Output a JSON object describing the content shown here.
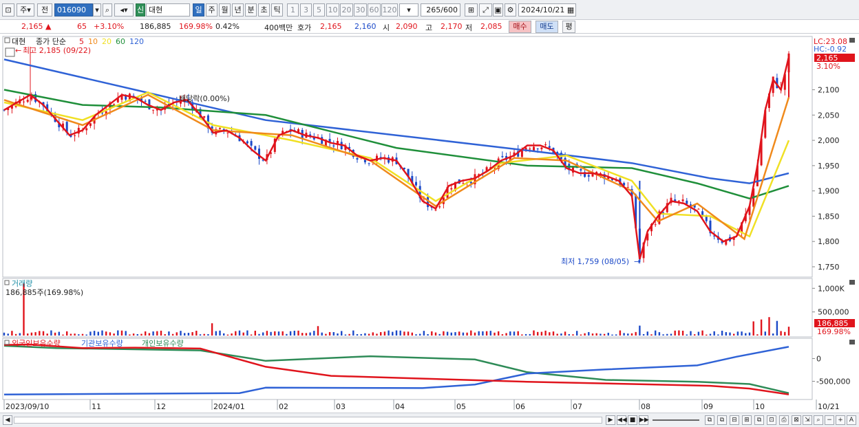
{
  "toolbar": {
    "period_main": "주",
    "prev_label": "전",
    "code": "016090",
    "name": "대현",
    "name_badge": "신",
    "periods": [
      "일",
      "주",
      "월",
      "년",
      "분",
      "초",
      "틱"
    ],
    "active_period": "일",
    "intervals": [
      "1",
      "3",
      "5",
      "10",
      "20",
      "30",
      "60",
      "120"
    ],
    "count": "265",
    "count_total": "/600",
    "date": "2024/10/21"
  },
  "quote": {
    "price": "2,165",
    "change": "65",
    "change_rate": "+3.10%",
    "volume": "186,885",
    "volume_rate": "169.98%",
    "turnover": "0.42%",
    "amount": "400백만",
    "hoga_label": "호가",
    "ask": "2,165",
    "bid": "2,160",
    "open_label": "시",
    "open": "2,090",
    "high_label": "고",
    "high": "2,170",
    "low_label": "저",
    "low": "2,085",
    "buy_label": "매수",
    "sell_label": "매도",
    "eval_label": "평"
  },
  "price_panel": {
    "stock_label": "대현",
    "ma_legend_title": "종가 단순",
    "ma_periods": [
      "5",
      "10",
      "20",
      "60",
      "120"
    ],
    "ma_colors": [
      "#e0141c",
      "#f08a1c",
      "#f0e024",
      "#1f8f3a",
      "#2f62d6"
    ],
    "high_note": "최고 2,185 (09/22)",
    "low_note": "최저 1,759 (08/05)",
    "dividend_note": "배당락(0.00%)",
    "lc_label": "LC:23.08",
    "hc_label": "HC:-0.92",
    "current_price_tag": "2,165",
    "current_rate_tag": "3.10%"
  },
  "volume_panel": {
    "title": "거래량",
    "value_text": "186,885주(169.98%)",
    "tag_value": "186,885",
    "tag_rate": "169.98%"
  },
  "holding_panel": {
    "legend": [
      "외국인보유수량",
      "기관보유수량",
      "개인보유수량"
    ],
    "colors": [
      "#e0141c",
      "#2f62d6",
      "#2e8b57"
    ]
  },
  "chart_data": {
    "type": "candlestick",
    "price_axis": {
      "ticks": [
        1750,
        1800,
        1850,
        1900,
        1950,
        2000,
        2050,
        2100
      ],
      "range": [
        1735,
        2200
      ]
    },
    "volume_axis": {
      "ticks": [
        "1,000K",
        "500,000"
      ],
      "values": [
        1000000,
        500000
      ],
      "range": [
        0,
        1150000
      ]
    },
    "holding_axis": {
      "ticks": [
        "0",
        "-500,000"
      ],
      "values": [
        0,
        -500000
      ],
      "range": [
        -870000,
        400000
      ]
    },
    "x_labels": [
      "2023/09/10",
      "11",
      "12",
      "2024/01",
      "02",
      "03",
      "04",
      "05",
      "06",
      "07",
      "08",
      "09",
      "10",
      "10/21"
    ],
    "price_close_path": [
      [
        0,
        2060
      ],
      [
        5,
        2075
      ],
      [
        10,
        2090
      ],
      [
        15,
        2070
      ],
      [
        20,
        2040
      ],
      [
        25,
        2010
      ],
      [
        30,
        2020
      ],
      [
        35,
        2050
      ],
      [
        40,
        2070
      ],
      [
        45,
        2090
      ],
      [
        50,
        2085
      ],
      [
        55,
        2070
      ],
      [
        60,
        2060
      ],
      [
        65,
        2075
      ],
      [
        70,
        2080
      ],
      [
        75,
        2050
      ],
      [
        80,
        2015
      ],
      [
        85,
        2020
      ],
      [
        90,
        2005
      ],
      [
        95,
        1980
      ],
      [
        100,
        1960
      ],
      [
        105,
        2010
      ],
      [
        110,
        2020
      ],
      [
        115,
        2010
      ],
      [
        120,
        2005
      ],
      [
        125,
        1995
      ],
      [
        130,
        1990
      ],
      [
        135,
        1970
      ],
      [
        140,
        1960
      ],
      [
        145,
        1965
      ],
      [
        150,
        1960
      ],
      [
        155,
        1925
      ],
      [
        160,
        1880
      ],
      [
        165,
        1865
      ],
      [
        170,
        1910
      ],
      [
        175,
        1920
      ],
      [
        180,
        1925
      ],
      [
        185,
        1940
      ],
      [
        190,
        1960
      ],
      [
        195,
        1970
      ],
      [
        200,
        1990
      ],
      [
        205,
        1990
      ],
      [
        210,
        1980
      ],
      [
        215,
        1945
      ],
      [
        220,
        1935
      ],
      [
        225,
        1935
      ],
      [
        230,
        1930
      ],
      [
        235,
        1920
      ],
      [
        240,
        1890
      ],
      [
        243,
        1765
      ],
      [
        246,
        1820
      ],
      [
        250,
        1850
      ],
      [
        255,
        1880
      ],
      [
        260,
        1875
      ],
      [
        265,
        1860
      ],
      [
        270,
        1820
      ],
      [
        275,
        1800
      ],
      [
        280,
        1810
      ],
      [
        285,
        1870
      ],
      [
        288,
        1950
      ],
      [
        291,
        2060
      ],
      [
        294,
        2120
      ],
      [
        297,
        2100
      ],
      [
        300,
        2165
      ]
    ],
    "ma120_path": [
      [
        0,
        2160
      ],
      [
        50,
        2100
      ],
      [
        100,
        2040
      ],
      [
        150,
        2010
      ],
      [
        200,
        1980
      ],
      [
        240,
        1955
      ],
      [
        270,
        1925
      ],
      [
        285,
        1915
      ],
      [
        300,
        1935
      ]
    ],
    "ma60_path": [
      [
        0,
        2100
      ],
      [
        30,
        2070
      ],
      [
        60,
        2065
      ],
      [
        100,
        2050
      ],
      [
        150,
        1985
      ],
      [
        200,
        1950
      ],
      [
        240,
        1945
      ],
      [
        265,
        1915
      ],
      [
        285,
        1885
      ],
      [
        300,
        1910
      ]
    ],
    "ma20_path": [
      [
        0,
        2075
      ],
      [
        30,
        2040
      ],
      [
        55,
        2095
      ],
      [
        80,
        2030
      ],
      [
        110,
        2000
      ],
      [
        140,
        1965
      ],
      [
        165,
        1880
      ],
      [
        190,
        1955
      ],
      [
        215,
        1970
      ],
      [
        240,
        1920
      ],
      [
        250,
        1855
      ],
      [
        270,
        1850
      ],
      [
        285,
        1810
      ],
      [
        300,
        2000
      ]
    ],
    "ma10_path": [
      [
        0,
        2080
      ],
      [
        30,
        2030
      ],
      [
        55,
        2090
      ],
      [
        80,
        2020
      ],
      [
        110,
        2010
      ],
      [
        140,
        1960
      ],
      [
        165,
        1870
      ],
      [
        195,
        1965
      ],
      [
        215,
        1960
      ],
      [
        240,
        1900
      ],
      [
        250,
        1840
      ],
      [
        265,
        1875
      ],
      [
        283,
        1805
      ],
      [
        300,
        2085
      ]
    ],
    "volume_series": [
      {
        "i": 8,
        "v": 1100000,
        "up": true
      },
      {
        "i": 80,
        "v": 260000,
        "up": true
      },
      {
        "i": 120,
        "v": 200000,
        "up": true
      },
      {
        "i": 243,
        "v": 210000,
        "up": false
      },
      {
        "i": 262,
        "v": 190000,
        "up": true
      },
      {
        "i": 287,
        "v": 300000,
        "up": true
      },
      {
        "i": 290,
        "v": 340000,
        "up": true
      },
      {
        "i": 293,
        "v": 390000,
        "up": true
      },
      {
        "i": 296,
        "v": 310000,
        "up": false
      },
      {
        "i": 300,
        "v": 186885,
        "up": true
      }
    ],
    "foreign_path": [
      [
        0,
        300000
      ],
      [
        10,
        310000
      ],
      [
        30,
        230000
      ],
      [
        50,
        240000
      ],
      [
        75,
        220000
      ],
      [
        100,
        -180000
      ],
      [
        125,
        -380000
      ],
      [
        160,
        -440000
      ],
      [
        200,
        -510000
      ],
      [
        240,
        -560000
      ],
      [
        270,
        -600000
      ],
      [
        285,
        -660000
      ],
      [
        300,
        -790000
      ]
    ],
    "institution_path": [
      [
        0,
        -790000
      ],
      [
        90,
        -760000
      ],
      [
        100,
        -640000
      ],
      [
        160,
        -650000
      ],
      [
        180,
        -570000
      ],
      [
        200,
        -330000
      ],
      [
        230,
        -240000
      ],
      [
        265,
        -150000
      ],
      [
        280,
        40000
      ],
      [
        300,
        260000
      ]
    ],
    "individual_path": [
      [
        0,
        280000
      ],
      [
        20,
        230000
      ],
      [
        75,
        180000
      ],
      [
        100,
        -50000
      ],
      [
        140,
        50000
      ],
      [
        180,
        -20000
      ],
      [
        200,
        -300000
      ],
      [
        230,
        -470000
      ],
      [
        265,
        -510000
      ],
      [
        285,
        -560000
      ],
      [
        300,
        -760000
      ]
    ]
  }
}
